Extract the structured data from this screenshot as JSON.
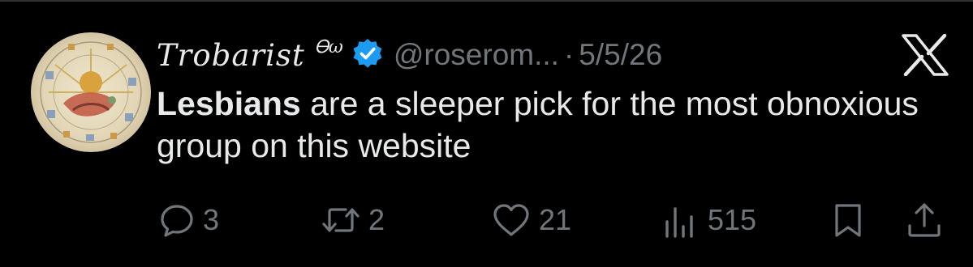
{
  "post": {
    "display_name": "Trobarist",
    "name_glyph": "Ꮎω",
    "handle": "@roserom...",
    "separator": "·",
    "date": "5/5/26",
    "text_bold": "Lesbians",
    "text_rest": " are a sleeper pick for the most obnoxious group on this website"
  },
  "actions": {
    "replies": "3",
    "reposts": "2",
    "likes": "21",
    "views": "515"
  },
  "colors": {
    "background": "#000000",
    "text": "#e7e9ea",
    "muted": "#71767b",
    "verified": "#1d9bf0"
  },
  "icons": {
    "reply": "speech-bubble-icon",
    "repost": "repost-arrows-icon",
    "like": "heart-icon",
    "views": "bar-chart-icon",
    "bookmark": "bookmark-icon",
    "share": "share-upload-icon",
    "brand": "x-logo-icon",
    "verified": "verified-badge-icon"
  }
}
